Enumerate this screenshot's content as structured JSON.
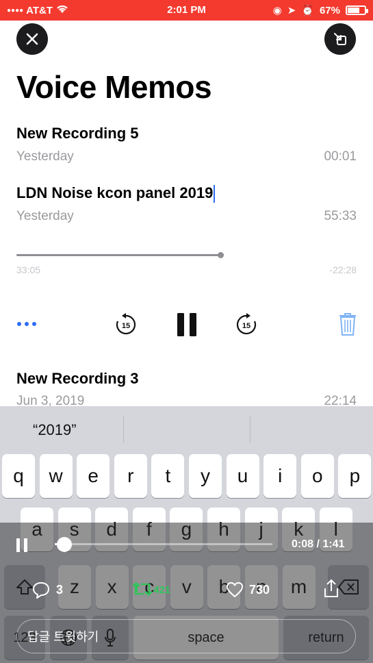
{
  "status": {
    "carrier": "AT&T",
    "time": "2:01 PM",
    "battery": "67%",
    "battery_level": 0.67
  },
  "header": {
    "title": "Voice Memos"
  },
  "recordings": [
    {
      "title": "New Recording 5",
      "date": "Yesterday",
      "duration": "00:01"
    },
    {
      "title": "LDN Noise kcon panel 2019",
      "date": "Yesterday",
      "duration": "55:33",
      "elapsed": "33:05",
      "remaining": "-22:28",
      "progress": 0.6
    },
    {
      "title": "New Recording 3",
      "date": "Jun 3, 2019",
      "duration": "22:14"
    }
  ],
  "icons": {
    "close": "close-icon",
    "minimize": "minimize-icon",
    "more": "more-icon",
    "skip_back": "skip-back-15-icon",
    "pause": "pause-icon",
    "skip_forward": "skip-forward-15-icon",
    "trash": "trash-icon",
    "accent": "#2c6cf6",
    "status_bar": "#f43a2f"
  },
  "keyboard": {
    "suggestion": "“2019”",
    "row1": [
      "q",
      "w",
      "e",
      "r",
      "t",
      "y",
      "u",
      "i",
      "o",
      "p"
    ],
    "row2": [
      "a",
      "s",
      "d",
      "f",
      "g",
      "h",
      "j",
      "k",
      "l"
    ],
    "row3": [
      "z",
      "x",
      "c",
      "v",
      "b",
      "n",
      "m"
    ],
    "numbers_key": "123",
    "space_key": "space",
    "return_key": "return"
  },
  "video_overlay": {
    "playback_time": "0:08 / 1:41",
    "playback_progress": 0.08,
    "replies": "3",
    "retweets": "421",
    "likes": "730",
    "reply_placeholder": "답글 트윗하기"
  }
}
